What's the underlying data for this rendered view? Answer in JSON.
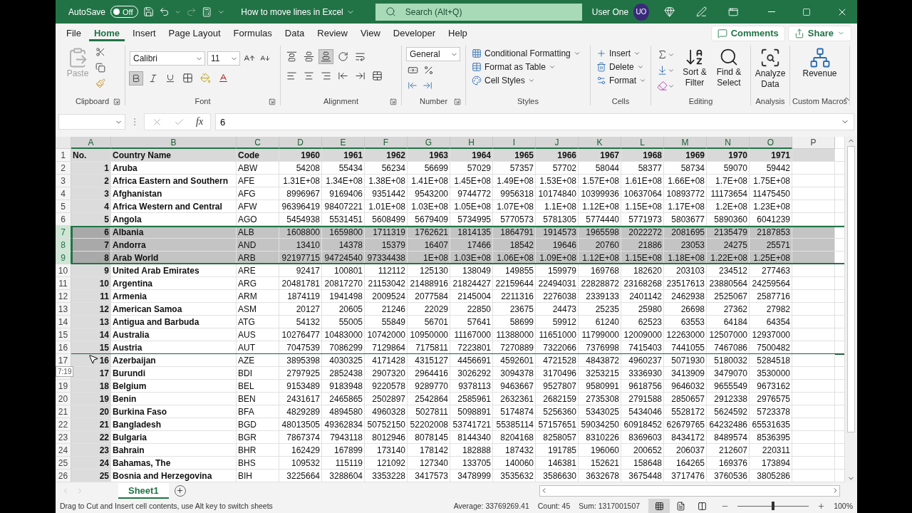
{
  "title_bar": {
    "autosave": {
      "label": "AutoSave",
      "state": "Off",
      "on": false
    },
    "document": "How to move lines in Excel",
    "search": {
      "placeholder": "Search (Alt+Q)"
    },
    "user": "User One",
    "initials": "UO"
  },
  "tabs": [
    {
      "label": "File",
      "selected": false
    },
    {
      "label": "Home",
      "selected": true
    },
    {
      "label": "Insert",
      "selected": false
    },
    {
      "label": "Page Layout",
      "selected": false
    },
    {
      "label": "Formulas",
      "selected": false
    },
    {
      "label": "Data",
      "selected": false
    },
    {
      "label": "Review",
      "selected": false
    },
    {
      "label": "View",
      "selected": false
    },
    {
      "label": "Developer",
      "selected": false
    },
    {
      "label": "Help",
      "selected": false
    }
  ],
  "actions": {
    "comments": "Comments",
    "share": "Share"
  },
  "ribbon": {
    "groups": [
      {
        "kind": "clipboard",
        "label": "Clipboard",
        "paste": {
          "label": "Paste",
          "disabled": true
        }
      },
      {
        "kind": "font",
        "label": "Font",
        "font": "Calibri",
        "size": "11",
        "bold": true
      },
      {
        "kind": "alignment",
        "label": "Alignment"
      },
      {
        "kind": "number",
        "label": "Number",
        "format": "General"
      },
      {
        "kind": "list",
        "label": "Styles",
        "items": [
          "Conditional Formatting",
          "Format as Table",
          "Cell Styles"
        ]
      },
      {
        "kind": "list",
        "label": "Cells",
        "items": [
          "Insert",
          "Delete",
          "Format"
        ]
      },
      {
        "kind": "editing",
        "label": "Editing",
        "items": [
          "Sort & Filter",
          "Find & Select"
        ]
      },
      {
        "kind": "big",
        "label": "Analysis",
        "items": [
          "Analyze Data"
        ]
      },
      {
        "kind": "big",
        "label": "Custom Macros",
        "items": [
          "Revenue"
        ]
      }
    ]
  },
  "formula_bar": {
    "function_label": "fx",
    "value": "6"
  },
  "sheet": {
    "columns": [
      {
        "letter": "A",
        "selected": true,
        "shaded": true
      },
      {
        "letter": "B",
        "selected": true,
        "shaded": false
      },
      {
        "letter": "C",
        "selected": true,
        "shaded": false
      },
      {
        "letter": "D",
        "selected": true,
        "shaded": false
      },
      {
        "letter": "E",
        "selected": true,
        "shaded": false
      },
      {
        "letter": "F",
        "selected": true,
        "shaded": false
      },
      {
        "letter": "G",
        "selected": true,
        "shaded": false
      },
      {
        "letter": "H",
        "selected": true,
        "shaded": false
      },
      {
        "letter": "I",
        "selected": true,
        "shaded": false
      },
      {
        "letter": "J",
        "selected": true,
        "shaded": false
      },
      {
        "letter": "K",
        "selected": true,
        "shaded": false
      },
      {
        "letter": "L",
        "selected": true,
        "shaded": false
      },
      {
        "letter": "M",
        "selected": true,
        "shaded": false
      },
      {
        "letter": "N",
        "selected": true,
        "shaded": false
      },
      {
        "letter": "O",
        "selected": true,
        "shaded": false
      },
      {
        "letter": "P",
        "selected": false,
        "shaded": false
      }
    ],
    "rows": [
      {
        "n": "1",
        "kind": "header",
        "selected": false,
        "drop_target": false,
        "cells": [
          "No.",
          "Country Name",
          "Code",
          "1960",
          "1961",
          "1962",
          "1963",
          "1964",
          "1965",
          "1966",
          "1967",
          "1968",
          "1969",
          "1970",
          "1971"
        ]
      },
      {
        "n": "2",
        "kind": "data",
        "selected": false,
        "drop_target": false,
        "cells": [
          "1",
          "Aruba",
          "ABW",
          "54208",
          "55434",
          "56234",
          "56699",
          "57029",
          "57357",
          "57702",
          "58044",
          "58377",
          "58734",
          "59070",
          "59442"
        ]
      },
      {
        "n": "3",
        "kind": "data",
        "selected": false,
        "drop_target": false,
        "cells": [
          "2",
          "Africa Eastern and Southern",
          "AFE",
          "1.31E+08",
          "1.34E+08",
          "1.38E+08",
          "1.41E+08",
          "1.45E+08",
          "1.49E+08",
          "1.53E+08",
          "1.57E+08",
          "1.61E+08",
          "1.66E+08",
          "1.7E+08",
          "1.75E+08"
        ]
      },
      {
        "n": "4",
        "kind": "data",
        "selected": false,
        "drop_target": false,
        "cells": [
          "3",
          "Afghanistan",
          "AFG",
          "8996967",
          "9169406",
          "9351442",
          "9543200",
          "9744772",
          "9956318",
          "10174840",
          "10399936",
          "10637064",
          "10893772",
          "11173654",
          "11475450"
        ]
      },
      {
        "n": "5",
        "kind": "data",
        "selected": false,
        "drop_target": false,
        "cells": [
          "4",
          "Africa Western and Central",
          "AFW",
          "96396419",
          "98407221",
          "1.01E+08",
          "1.03E+08",
          "1.05E+08",
          "1.07E+08",
          "1.1E+08",
          "1.12E+08",
          "1.15E+08",
          "1.17E+08",
          "1.2E+08",
          "1.23E+08"
        ]
      },
      {
        "n": "6",
        "kind": "data",
        "selected": false,
        "drop_target": false,
        "cells": [
          "5",
          "Angola",
          "AGO",
          "5454938",
          "5531451",
          "5608499",
          "5679409",
          "5734995",
          "5770573",
          "5781305",
          "5774440",
          "5771973",
          "5803677",
          "5890360",
          "6041239"
        ]
      },
      {
        "n": "7",
        "kind": "data",
        "selected": true,
        "drop_target": false,
        "cells": [
          "6",
          "Albania",
          "ALB",
          "1608800",
          "1659800",
          "1711319",
          "1762621",
          "1814135",
          "1864791",
          "1914573",
          "1965598",
          "2022272",
          "2081695",
          "2135479",
          "2187853"
        ]
      },
      {
        "n": "8",
        "kind": "data",
        "selected": true,
        "drop_target": false,
        "cells": [
          "7",
          "Andorra",
          "AND",
          "13410",
          "14378",
          "15379",
          "16407",
          "17466",
          "18542",
          "19646",
          "20760",
          "21886",
          "23053",
          "24275",
          "25571"
        ]
      },
      {
        "n": "9",
        "kind": "data",
        "selected": true,
        "drop_target": false,
        "cells": [
          "8",
          "Arab World",
          "ARB",
          "92197715",
          "94724540",
          "97334438",
          "1E+08",
          "1.03E+08",
          "1.06E+08",
          "1.09E+08",
          "1.12E+08",
          "1.15E+08",
          "1.18E+08",
          "1.22E+08",
          "1.25E+08"
        ]
      },
      {
        "n": "10",
        "kind": "data",
        "selected": false,
        "drop_target": false,
        "cells": [
          "9",
          "United Arab Emirates",
          "ARE",
          "92417",
          "100801",
          "112112",
          "125130",
          "138049",
          "149855",
          "159979",
          "169768",
          "182620",
          "203103",
          "234512",
          "277463"
        ]
      },
      {
        "n": "11",
        "kind": "data",
        "selected": false,
        "drop_target": false,
        "cells": [
          "10",
          "Argentina",
          "ARG",
          "20481781",
          "20817270",
          "21153042",
          "21488916",
          "21824427",
          "22159644",
          "22494031",
          "22828872",
          "23168268",
          "23517613",
          "23880564",
          "24259564"
        ]
      },
      {
        "n": "12",
        "kind": "data",
        "selected": false,
        "drop_target": false,
        "cells": [
          "11",
          "Armenia",
          "ARM",
          "1874119",
          "1941498",
          "2009524",
          "2077584",
          "2145004",
          "2211316",
          "2276038",
          "2339133",
          "2401142",
          "2462938",
          "2525067",
          "2587716"
        ]
      },
      {
        "n": "13",
        "kind": "data",
        "selected": false,
        "drop_target": false,
        "cells": [
          "12",
          "American Samoa",
          "ASM",
          "20127",
          "20605",
          "21246",
          "22029",
          "22850",
          "23675",
          "24473",
          "25235",
          "25980",
          "26698",
          "27362",
          "27982"
        ]
      },
      {
        "n": "14",
        "kind": "data",
        "selected": false,
        "drop_target": false,
        "cells": [
          "13",
          "Antigua and Barbuda",
          "ATG",
          "54132",
          "55005",
          "55849",
          "56701",
          "57641",
          "58699",
          "59912",
          "61240",
          "62523",
          "63553",
          "64184",
          "64354"
        ]
      },
      {
        "n": "15",
        "kind": "data",
        "selected": false,
        "drop_target": false,
        "cells": [
          "14",
          "Australia",
          "AUS",
          "10276477",
          "10483000",
          "10742000",
          "10950000",
          "11167000",
          "11388000",
          "11651000",
          "11799000",
          "12009000",
          "12263000",
          "12507000",
          "12937000"
        ]
      },
      {
        "n": "16",
        "kind": "data",
        "selected": false,
        "drop_target": true,
        "cells": [
          "15",
          "Austria",
          "AUT",
          "7047539",
          "7086299",
          "7129864",
          "7175811",
          "7223801",
          "7270889",
          "7322066",
          "7376998",
          "7415403",
          "7441055",
          "7467086",
          "7500482"
        ]
      },
      {
        "n": "17",
        "kind": "data",
        "selected": false,
        "drop_target": false,
        "cells": [
          "16",
          "Azerbaijan",
          "AZE",
          "3895398",
          "4030325",
          "4171428",
          "4315127",
          "4456691",
          "4592601",
          "4721528",
          "4843872",
          "4960237",
          "5071930",
          "5180032",
          "5284518"
        ]
      },
      {
        "kind": "data",
        "selected": false,
        "drop_target": false,
        "cells": [
          "17",
          "Burundi",
          "BDI",
          "2797925",
          "2852438",
          "2907320",
          "2964416",
          "3026292",
          "3094378",
          "3170496",
          "3253215",
          "3336930",
          "3413909",
          "3479070",
          "3530000"
        ]
      },
      {
        "n": "19",
        "kind": "data",
        "selected": false,
        "drop_target": false,
        "cells": [
          "18",
          "Belgium",
          "BEL",
          "9153489",
          "9183948",
          "9220578",
          "9289770",
          "9378113",
          "9463667",
          "9527807",
          "9580991",
          "9618756",
          "9646032",
          "9655549",
          "9673162"
        ]
      },
      {
        "n": "20",
        "kind": "data",
        "selected": false,
        "drop_target": false,
        "cells": [
          "19",
          "Benin",
          "BEN",
          "2431617",
          "2465865",
          "2502897",
          "2542864",
          "2585961",
          "2632361",
          "2682159",
          "2735308",
          "2791588",
          "2850657",
          "2912338",
          "2976575"
        ]
      },
      {
        "n": "21",
        "kind": "data",
        "selected": false,
        "drop_target": false,
        "cells": [
          "20",
          "Burkina Faso",
          "BFA",
          "4829289",
          "4894580",
          "4960328",
          "5027811",
          "5098891",
          "5174874",
          "5256360",
          "5343025",
          "5434046",
          "5528172",
          "5624592",
          "5723378"
        ]
      },
      {
        "n": "22",
        "kind": "data",
        "selected": false,
        "drop_target": false,
        "cells": [
          "21",
          "Bangladesh",
          "BGD",
          "48013505",
          "49362834",
          "50752150",
          "52202008",
          "53741721",
          "55385114",
          "57157651",
          "59034250",
          "60918452",
          "62679765",
          "64232486",
          "65531635"
        ]
      },
      {
        "n": "23",
        "kind": "data",
        "selected": false,
        "drop_target": false,
        "cells": [
          "22",
          "Bulgaria",
          "BGR",
          "7867374",
          "7943118",
          "8012946",
          "8078145",
          "8144340",
          "8204168",
          "8258057",
          "8310226",
          "8369603",
          "8434172",
          "8489574",
          "8536395"
        ]
      },
      {
        "n": "24",
        "kind": "data",
        "selected": false,
        "drop_target": false,
        "cells": [
          "23",
          "Bahrain",
          "BHR",
          "162429",
          "167899",
          "173140",
          "178142",
          "182888",
          "187432",
          "191785",
          "196060",
          "200652",
          "206037",
          "212607",
          "220311"
        ]
      },
      {
        "n": "25",
        "kind": "data",
        "selected": false,
        "drop_target": false,
        "cells": [
          "24",
          "Bahamas, The",
          "BHS",
          "109532",
          "115119",
          "121092",
          "127340",
          "133705",
          "140060",
          "146381",
          "152621",
          "158648",
          "164265",
          "169376",
          "173894"
        ]
      },
      {
        "n": "26",
        "kind": "data",
        "selected": false,
        "drop_target": false,
        "cells": [
          "25",
          "Bosnia and Herzegovina",
          "BIH",
          "3225664",
          "3288604",
          "3353228",
          "3417573",
          "3478999",
          "3535632",
          "3586630",
          "3632678",
          "3675448",
          "3717476",
          "3760536",
          "3805286"
        ]
      }
    ]
  },
  "tooltip": "7:19",
  "sheet_tabs": [
    {
      "label": "Sheet1",
      "selected": true
    }
  ],
  "status_bar": {
    "message": "Drag to Cut and Insert cell contents, use Alt key to switch sheets",
    "average": "Average: 33769269.41",
    "count": "Count: 45",
    "sum": "Sum: 1317001507",
    "views": [
      {
        "selected": true
      },
      {
        "selected": false
      },
      {
        "selected": false
      }
    ],
    "zoom": {
      "level": 0.5,
      "reading": "100%"
    }
  }
}
